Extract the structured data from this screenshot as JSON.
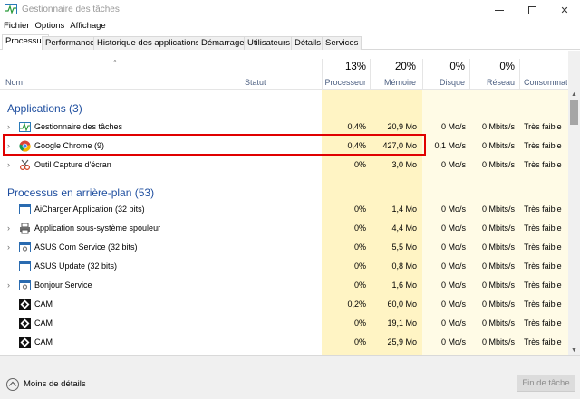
{
  "window": {
    "title": "Gestionnaire des tâches"
  },
  "menu": [
    "Fichier",
    "Options",
    "Affichage"
  ],
  "tabs": [
    "Processus",
    "Performance",
    "Historique des applications",
    "Démarrage",
    "Utilisateurs",
    "Détails",
    "Services"
  ],
  "active_tab": "Processus",
  "columns": {
    "name": "Nom",
    "status": "Statut",
    "cpu": {
      "pct": "13%",
      "label": "Processeur"
    },
    "memory": {
      "pct": "20%",
      "label": "Mémoire"
    },
    "disk": {
      "pct": "0%",
      "label": "Disque"
    },
    "network": {
      "pct": "0%",
      "label": "Réseau"
    },
    "power": {
      "label": "Consommatio..."
    }
  },
  "groups": {
    "apps": {
      "label": "Applications (3)"
    },
    "background": {
      "label": "Processus en arrière-plan (53)"
    }
  },
  "apps": [
    {
      "name": "Gestionnaire des tâches",
      "cpu": "0,4%",
      "mem": "20,9 Mo",
      "disk": "0 Mo/s",
      "net": "0 Mbits/s",
      "power": "Très faible",
      "icon": "task-manager-icon",
      "expandable": true
    },
    {
      "name": "Google Chrome (9)",
      "cpu": "0,4%",
      "mem": "427,0 Mo",
      "disk": "0,1 Mo/s",
      "net": "0 Mbits/s",
      "power": "Très faible",
      "icon": "chrome-icon",
      "expandable": true,
      "highlighted": true
    },
    {
      "name": "Outil Capture d'écran",
      "cpu": "0%",
      "mem": "3,0 Mo",
      "disk": "0 Mo/s",
      "net": "0 Mbits/s",
      "power": "Très faible",
      "icon": "snipping-tool-icon",
      "expandable": true
    }
  ],
  "background": [
    {
      "name": "AiCharger Application (32 bits)",
      "cpu": "0%",
      "mem": "1,4 Mo",
      "disk": "0 Mo/s",
      "net": "0 Mbits/s",
      "power": "Très faible",
      "icon": "app-window-icon",
      "expandable": false
    },
    {
      "name": "Application sous-système spouleur",
      "cpu": "0%",
      "mem": "4,4 Mo",
      "disk": "0 Mo/s",
      "net": "0 Mbits/s",
      "power": "Très faible",
      "icon": "printer-icon",
      "expandable": true
    },
    {
      "name": "ASUS Com Service (32 bits)",
      "cpu": "0%",
      "mem": "5,5 Mo",
      "disk": "0 Mo/s",
      "net": "0 Mbits/s",
      "power": "Très faible",
      "icon": "service-icon",
      "expandable": true
    },
    {
      "name": "ASUS Update (32 bits)",
      "cpu": "0%",
      "mem": "0,8 Mo",
      "disk": "0 Mo/s",
      "net": "0 Mbits/s",
      "power": "Très faible",
      "icon": "app-window-icon",
      "expandable": false
    },
    {
      "name": "Bonjour Service",
      "cpu": "0%",
      "mem": "1,6 Mo",
      "disk": "0 Mo/s",
      "net": "0 Mbits/s",
      "power": "Très faible",
      "icon": "service-icon",
      "expandable": true
    },
    {
      "name": "CAM",
      "cpu": "0,2%",
      "mem": "60,0 Mo",
      "disk": "0 Mo/s",
      "net": "0 Mbits/s",
      "power": "Très faible",
      "icon": "cam-icon",
      "expandable": false
    },
    {
      "name": "CAM",
      "cpu": "0%",
      "mem": "19,1 Mo",
      "disk": "0 Mo/s",
      "net": "0 Mbits/s",
      "power": "Très faible",
      "icon": "cam-icon",
      "expandable": false
    },
    {
      "name": "CAM",
      "cpu": "0%",
      "mem": "25,9 Mo",
      "disk": "0 Mo/s",
      "net": "0 Mbits/s",
      "power": "Très faible",
      "icon": "cam-icon",
      "expandable": false
    }
  ],
  "footer": {
    "fewer_details": "Moins de détails",
    "end_task": "Fin de tâche"
  },
  "colors": {
    "heat_cpu": "#fff4c4",
    "heat_mem": "#fff4c4",
    "group_text": "#1e4e9f",
    "highlight": "#e00000"
  }
}
